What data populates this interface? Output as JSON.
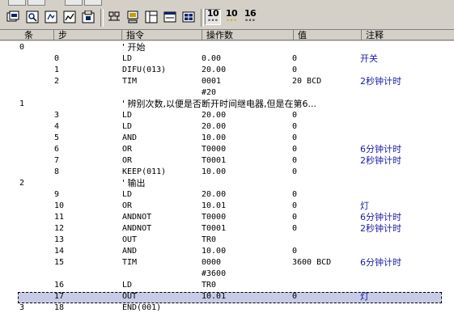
{
  "toolbar": {
    "buttons": [
      {
        "name": "new-program-icon"
      },
      {
        "name": "open-search-icon"
      },
      {
        "name": "online-edit-icon"
      },
      {
        "name": "compare-icon"
      },
      {
        "name": "settings-icon"
      },
      {
        "name": "ladder-view-icon"
      },
      {
        "name": "monitor-icon"
      },
      {
        "name": "mnemonic-view-icon"
      },
      {
        "name": "window-icon"
      },
      {
        "name": "grid-icon"
      }
    ],
    "num_buttons": [
      "10",
      "10",
      "16"
    ]
  },
  "header": {
    "col_cond": "条",
    "col_step": "步",
    "col_instr": "指令",
    "col_operand": "操作数",
    "col_value": "值",
    "col_note": "注释"
  },
  "rows": [
    {
      "cond": "0",
      "step": "",
      "instr": "",
      "operand": "",
      "value": "",
      "note": "",
      "comment": "' 开始"
    },
    {
      "cond": "",
      "step": "0",
      "instr": "LD",
      "operand": "0.00",
      "value": "0",
      "note": "开关",
      "comment": ""
    },
    {
      "cond": "",
      "step": "1",
      "instr": "DIFU(013)",
      "operand": "20.00",
      "value": "0",
      "note": "",
      "comment": ""
    },
    {
      "cond": "",
      "step": "2",
      "instr": "TIM",
      "operand": "0001",
      "value": "20 BCD",
      "note": "2秒钟计时",
      "comment": ""
    },
    {
      "cond": "",
      "step": "",
      "instr": "",
      "operand": "#20",
      "value": "",
      "note": "",
      "comment": ""
    },
    {
      "cond": "1",
      "step": "",
      "instr": "",
      "operand": "",
      "value": "",
      "note": "",
      "comment": "' 辨别次数,以便是否断开时间继电器,但是在第6..."
    },
    {
      "cond": "",
      "step": "3",
      "instr": "LD",
      "operand": "20.00",
      "value": "0",
      "note": "",
      "comment": ""
    },
    {
      "cond": "",
      "step": "4",
      "instr": "LD",
      "operand": "20.00",
      "value": "0",
      "note": "",
      "comment": ""
    },
    {
      "cond": "",
      "step": "5",
      "instr": "AND",
      "operand": "10.00",
      "value": "0",
      "note": "",
      "comment": ""
    },
    {
      "cond": "",
      "step": "6",
      "instr": "OR",
      "operand": "T0000",
      "value": "0",
      "note": "6分钟计时",
      "comment": ""
    },
    {
      "cond": "",
      "step": "7",
      "instr": "OR",
      "operand": "T0001",
      "value": "0",
      "note": "2秒钟计时",
      "comment": ""
    },
    {
      "cond": "",
      "step": "8",
      "instr": "KEEP(011)",
      "operand": "10.00",
      "value": "0",
      "note": "",
      "comment": ""
    },
    {
      "cond": "2",
      "step": "",
      "instr": "",
      "operand": "",
      "value": "",
      "note": "",
      "comment": "' 输出"
    },
    {
      "cond": "",
      "step": "9",
      "instr": "LD",
      "operand": "20.00",
      "value": "0",
      "note": "",
      "comment": ""
    },
    {
      "cond": "",
      "step": "10",
      "instr": "OR",
      "operand": "10.01",
      "value": "0",
      "note": "灯",
      "comment": ""
    },
    {
      "cond": "",
      "step": "11",
      "instr": "ANDNOT",
      "operand": "T0000",
      "value": "0",
      "note": "6分钟计时",
      "comment": ""
    },
    {
      "cond": "",
      "step": "12",
      "instr": "ANDNOT",
      "operand": "T0001",
      "value": "0",
      "note": "2秒钟计时",
      "comment": ""
    },
    {
      "cond": "",
      "step": "13",
      "instr": "OUT",
      "operand": "TR0",
      "value": "",
      "note": "",
      "comment": ""
    },
    {
      "cond": "",
      "step": "14",
      "instr": "AND",
      "operand": "10.00",
      "value": "0",
      "note": "",
      "comment": ""
    },
    {
      "cond": "",
      "step": "15",
      "instr": "TIM",
      "operand": "0000",
      "value": "3600 BCD",
      "note": "6分钟计时",
      "comment": ""
    },
    {
      "cond": "",
      "step": "",
      "instr": "",
      "operand": "#3600",
      "value": "",
      "note": "",
      "comment": ""
    },
    {
      "cond": "",
      "step": "16",
      "instr": "LD",
      "operand": "TR0",
      "value": "",
      "note": "",
      "comment": ""
    },
    {
      "cond": "",
      "step": "17",
      "instr": "OUT",
      "operand": "10.01",
      "value": "0",
      "note": "灯",
      "comment": ""
    },
    {
      "cond": "3",
      "step": "18",
      "instr": "END(001)",
      "operand": "",
      "value": "",
      "note": "",
      "comment": ""
    }
  ]
}
